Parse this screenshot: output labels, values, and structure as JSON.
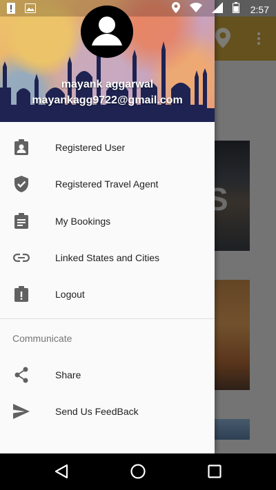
{
  "status_bar": {
    "time": "2:57",
    "left_icons": [
      "alert-icon",
      "image-icon"
    ],
    "right_icons": [
      "location-icon",
      "wifi-icon",
      "signal-icon",
      "battery-icon"
    ]
  },
  "background_app": {
    "toolbar_icons": [
      "location-pin-icon",
      "more-vert-icon"
    ],
    "card_letter": "S"
  },
  "drawer": {
    "header": {
      "user_name": "mayank aggarwal",
      "user_email": "mayankagg9722@gmail.com"
    },
    "menu_items": [
      {
        "label": "Registered User",
        "icon": "assignment-ind-icon"
      },
      {
        "label": "Registered Travel Agent",
        "icon": "verified-shield-icon"
      },
      {
        "label": "My Bookings",
        "icon": "assignment-icon"
      },
      {
        "label": "Linked States and Cities",
        "icon": "link-icon"
      },
      {
        "label": "Logout",
        "icon": "assignment-late-icon"
      }
    ],
    "section_title": "Communicate",
    "communicate_items": [
      {
        "label": "Share",
        "icon": "share-icon"
      },
      {
        "label": "Send Us FeedBack",
        "icon": "send-icon"
      }
    ]
  },
  "nav_bar": {
    "buttons": [
      "back-icon",
      "home-icon",
      "recents-icon"
    ]
  },
  "colors": {
    "drawer_background": "#fafafa",
    "icon_color": "#616161",
    "text_primary": "#212121",
    "text_secondary": "#757575",
    "toolbar_accent": "#c9a23a"
  }
}
